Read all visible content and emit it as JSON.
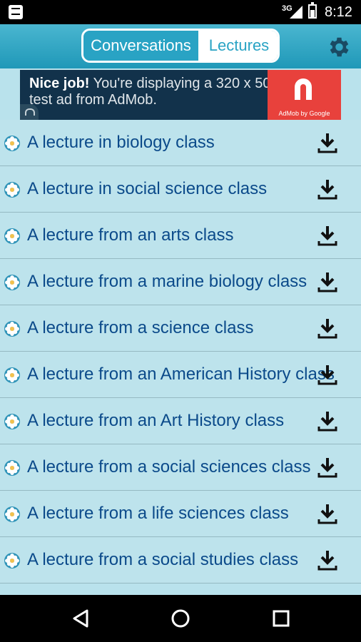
{
  "status_bar": {
    "network": "3G",
    "time": "8:12"
  },
  "header": {
    "tabs": [
      {
        "label": "Conversations",
        "active": true
      },
      {
        "label": "Lectures",
        "active": false
      }
    ],
    "settings_icon": "gear-icon"
  },
  "ad": {
    "headline": "Nice job!",
    "body": " You're displaying a 320 x 50 test ad from AdMob.",
    "brand": "AdMob by Google"
  },
  "lectures": [
    {
      "title": "A lecture in biology class"
    },
    {
      "title": "A lecture in social science class"
    },
    {
      "title": "A lecture from an arts class"
    },
    {
      "title": "A lecture from a marine biology class"
    },
    {
      "title": "A lecture from a science class"
    },
    {
      "title": "A lecture from an American History class"
    },
    {
      "title": "A lecture from an Art History class"
    },
    {
      "title": "A lecture from a social sciences class"
    },
    {
      "title": "A lecture from a life sciences class"
    },
    {
      "title": "A lecture from a social studies class"
    }
  ],
  "nav": {
    "back_icon": "back-icon",
    "home_icon": "home-icon",
    "recents_icon": "recents-icon"
  },
  "colors": {
    "header": "#1f98b8",
    "list_bg": "#bde3ec",
    "title_text": "#0b4a8a",
    "ad_bg": "#12324b",
    "ad_logo": "#e8413c"
  }
}
